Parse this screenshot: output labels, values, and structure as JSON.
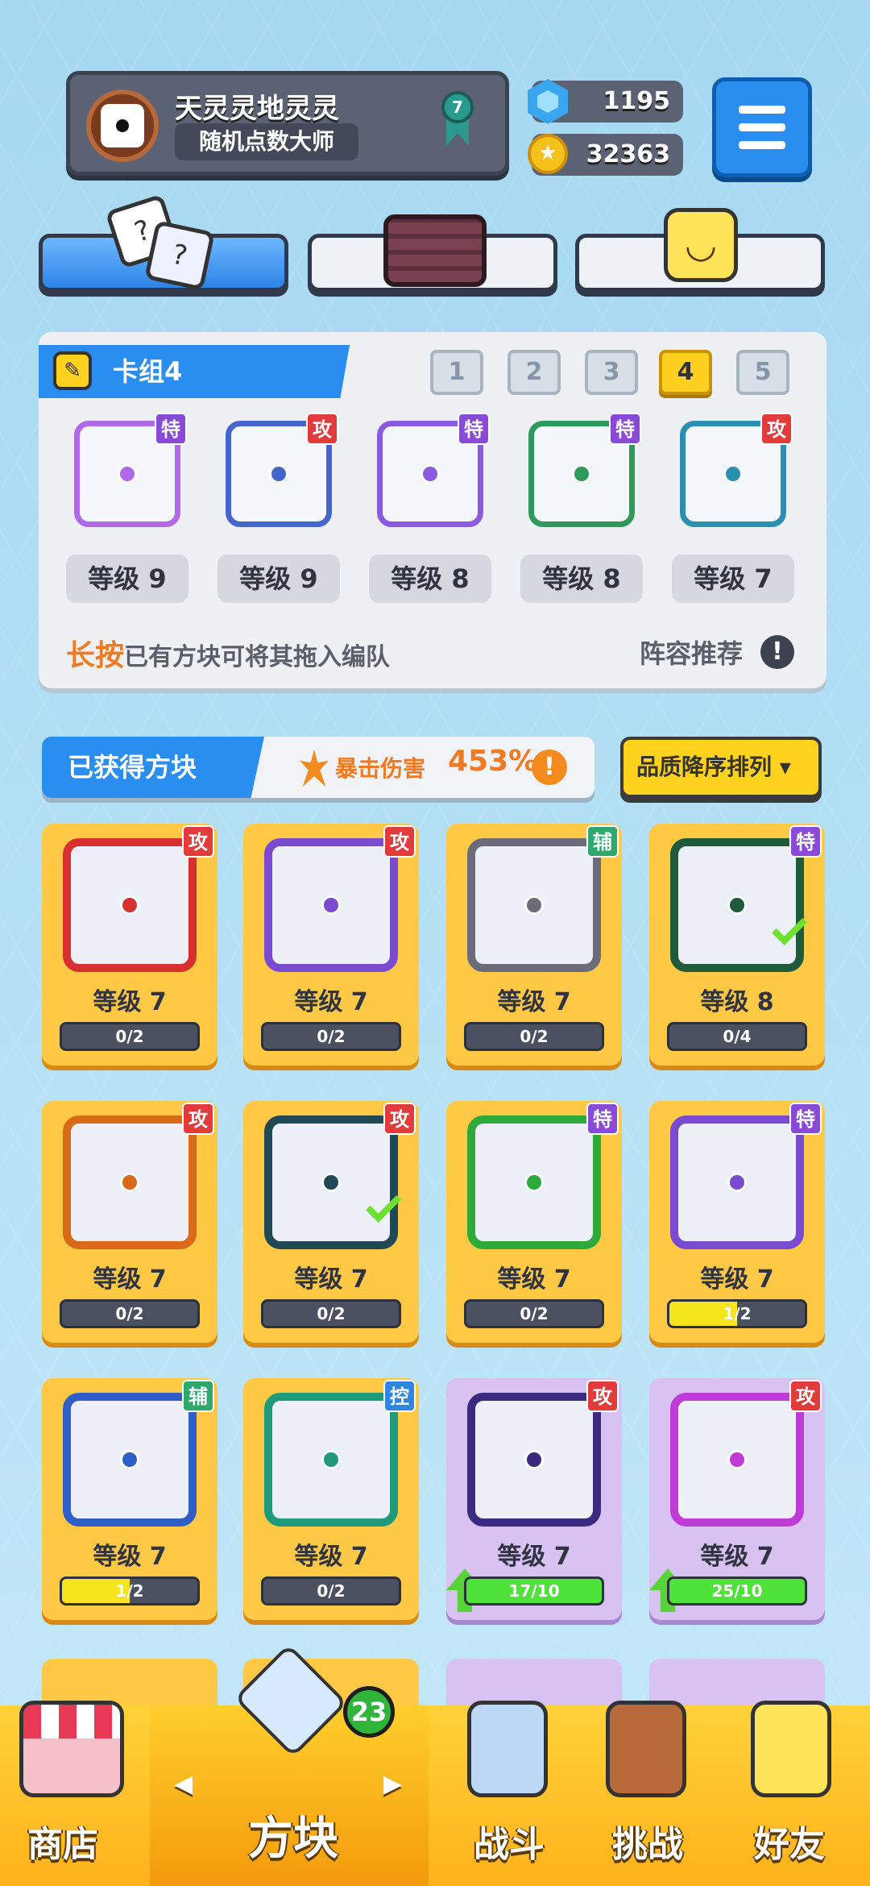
{
  "profile": {
    "name": "天灵灵地灵灵",
    "title": "随机点数大师",
    "rank": "7"
  },
  "currency": {
    "gems": "1195",
    "coins": "32363"
  },
  "deck": {
    "label": "卡组4",
    "numbers": [
      "1",
      "2",
      "3",
      "4",
      "5"
    ],
    "active": "4",
    "slots": [
      {
        "badge": "特",
        "level": "等级 9",
        "color": "#b06ae8"
      },
      {
        "badge": "攻",
        "level": "等级 9",
        "color": "#4466cc"
      },
      {
        "badge": "特",
        "level": "等级 8",
        "color": "#8a5ae0"
      },
      {
        "badge": "特",
        "level": "等级 8",
        "color": "#2e9a5a"
      },
      {
        "badge": "攻",
        "level": "等级 7",
        "color": "#2a8fb0"
      }
    ],
    "hint_emphasis": "长按",
    "hint_text": "已有方块可将其拖入编队",
    "recommend": "阵容推荐"
  },
  "owned": {
    "label": "已获得方块",
    "crit_label": "暴击伤害",
    "crit_value": "453%",
    "sort_label": "品质降序排列 ▾"
  },
  "cards": [
    {
      "badge": "攻",
      "level": "等级 7",
      "progress": "0/2",
      "frac": 0,
      "color": "#d83030",
      "style": "gold"
    },
    {
      "badge": "攻",
      "level": "等级 7",
      "progress": "0/2",
      "frac": 0,
      "color": "#7a4ad0",
      "style": "gold"
    },
    {
      "badge": "辅",
      "level": "等级 7",
      "progress": "0/2",
      "frac": 0,
      "color": "#6b6b7a",
      "style": "gold"
    },
    {
      "badge": "特",
      "level": "等级 8",
      "progress": "0/4",
      "frac": 0,
      "color": "#1f5a3a",
      "style": "gold",
      "check": true
    },
    {
      "badge": "攻",
      "level": "等级 7",
      "progress": "0/2",
      "frac": 0,
      "color": "#d86a18",
      "style": "gold"
    },
    {
      "badge": "攻",
      "level": "等级 7",
      "progress": "0/2",
      "frac": 0,
      "color": "#1f4a55",
      "style": "gold",
      "check": true
    },
    {
      "badge": "特",
      "level": "等级 7",
      "progress": "0/2",
      "frac": 0,
      "color": "#2eaa3a",
      "style": "gold"
    },
    {
      "badge": "特",
      "level": "等级 7",
      "progress": "1/2",
      "frac": 0.5,
      "color": "#7a4ad0",
      "style": "gold"
    },
    {
      "badge": "辅",
      "level": "等级 7",
      "progress": "1/2",
      "frac": 0.5,
      "color": "#2f5ec8",
      "style": "gold"
    },
    {
      "badge": "控",
      "level": "等级 7",
      "progress": "0/2",
      "frac": 0,
      "color": "#1f9a7a",
      "style": "gold"
    },
    {
      "badge": "攻",
      "level": "等级 7",
      "progress": "17/10",
      "frac": 1,
      "color": "#3a2a80",
      "style": "purple",
      "up": true
    },
    {
      "badge": "攻",
      "level": "等级 7",
      "progress": "25/10",
      "frac": 1,
      "color": "#c03ad8",
      "style": "purple",
      "up": true
    }
  ],
  "nav": {
    "shop": "商店",
    "blocks": "方块",
    "battle": "战斗",
    "challenge": "挑战",
    "friends": "好友",
    "badge_count": "23"
  }
}
